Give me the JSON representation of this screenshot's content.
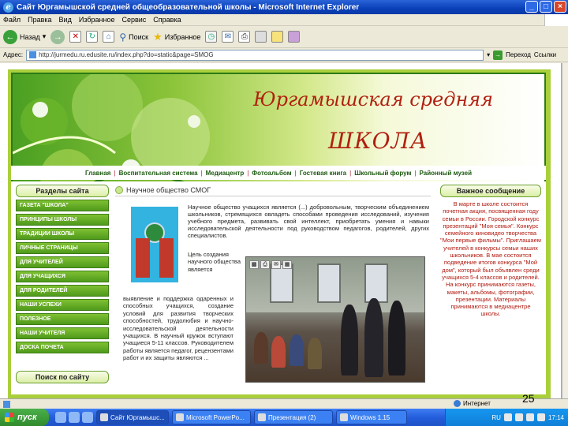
{
  "window": {
    "title": "Сайт Юргамышской средней общеобразовательной школы - Microsoft Internet Explorer",
    "controls": [
      "_",
      "□",
      "×"
    ]
  },
  "menu": [
    "Файл",
    "Правка",
    "Вид",
    "Избранное",
    "Сервис",
    "Справка"
  ],
  "toolbar": {
    "back_label": "Назад",
    "search_label": "Поиск",
    "favorites_label": "Избранное"
  },
  "address": {
    "label": "Адрес:",
    "url": "http://jurmedu.ru.edusite.ru/index.php?do=static&page=SMOG",
    "go_label": "Переход",
    "links_label": "Ссылки"
  },
  "site": {
    "title_line1": "Юргамышская средняя",
    "title_line2": "ШКОЛА",
    "nav": [
      "Главная",
      "Воспитательная система",
      "Медиацентр",
      "Фотоальбом",
      "Гостевая книга",
      "Школьный форум",
      "Районный музей"
    ],
    "sections_header": "Разделы сайта",
    "sections": [
      "ГАЗЕТА \"ШКОЛА\"",
      "ПРИНЦИПЫ ШКОЛЫ",
      "ТРАДИЦИИ ШКОЛЫ",
      "ЛИЧНЫЕ СТРАНИЦЫ",
      "ДЛЯ УЧИТЕЛЕЙ",
      "ДЛЯ УЧАЩИХСЯ",
      "ДЛЯ РОДИТЕЛЕЙ",
      "НАШИ УСПЕХИ",
      "ПОЛЕЗНОЕ",
      "НАШИ УЧИТЕЛЯ",
      "ДОСКА ПОЧЕТА"
    ],
    "search_header": "Поиск по сайту",
    "article_heading": "Научное общество СМОГ",
    "article_p1": "Научное общество учащихся является (...) добровольным, творческим объединением школьников, стремящихся овладеть способами проведения исследований, изучения учебного предмета, развивать свой интеллект, приобретать умения и навыки исследовательской деятельности под руководством педагогов, родителей, других специалистов.",
    "article_short": "Цель создания научного общества является",
    "article_p2": "выявление и поддержка одаренных и способных учащихся, создание условий для развития творческих способностей, трудолюбия и научно-исследовательской деятельности учащихся. В научный кружок вступают учащиеся 5-11 классов. Руководителем работы является педагог, рецензентами работ и их защиты являются ...",
    "important_header": "Важное сообщение",
    "important_text": "В марте в школе состоится почетная акция, посвященная году семьи в России. Городской конкурс презентаций \"Моя семья\". Конкурс семейного киновидео творчества \"Мои первые фильмы\". Приглашаем учителей в конкурсы семьи наших школьников. В мае состоится подведение итогов конкурса \"Мой дом\", который был объявлен среди учащихся 5-4 классов и родителей. На конкурс принимаются газеты, макеты, альбомы, фотографии, презентации. Материалы принимаются в медиацентре школы."
  },
  "slide_number": "25",
  "status": {
    "zone": "Интернет"
  },
  "taskbar": {
    "start": "пуск",
    "tasks": [
      "Сайт Юргамышс...",
      "Microsoft PowerPo...",
      "Презентация (2)",
      "Windows 1.15"
    ],
    "lang": "RU",
    "clock": "17:14"
  }
}
